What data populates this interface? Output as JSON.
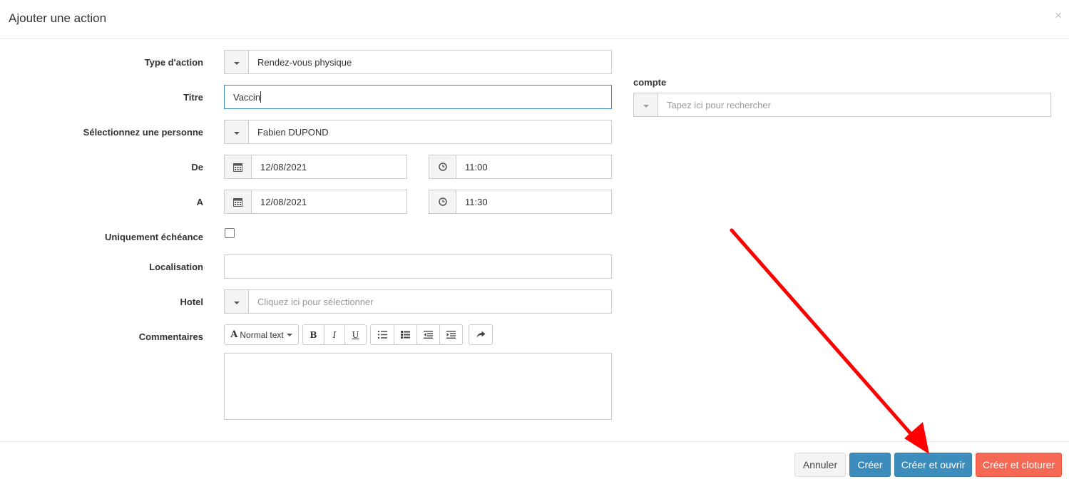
{
  "dialog": {
    "title": "Ajouter une action",
    "close_label": "×"
  },
  "form": {
    "type_action": {
      "label": "Type d'action",
      "value": "Rendez-vous physique"
    },
    "titre": {
      "label": "Titre",
      "value": "Vaccin"
    },
    "personne": {
      "label": "Sélectionnez une personne",
      "value": "Fabien DUPOND"
    },
    "de": {
      "label": "De",
      "date": "12/08/2021",
      "time": "11:00"
    },
    "a": {
      "label": "A",
      "date": "12/08/2021",
      "time": "11:30"
    },
    "echeance": {
      "label": "Uniquement échéance",
      "checked": false
    },
    "localisation": {
      "label": "Localisation",
      "value": ""
    },
    "hotel": {
      "label": "Hotel",
      "placeholder": "Cliquez ici pour sélectionner"
    },
    "commentaires": {
      "label": "Commentaires",
      "style_label": "Normal text"
    }
  },
  "compte": {
    "label": "compte",
    "placeholder": "Tapez ici pour rechercher"
  },
  "footer": {
    "cancel": "Annuler",
    "create": "Créer",
    "create_open": "Créer et ouvrir",
    "create_close": "Créer et cloturer"
  },
  "colors": {
    "primary": "#3c8dbc",
    "danger": "#f56954",
    "annotation_arrow": "#ff0000"
  }
}
